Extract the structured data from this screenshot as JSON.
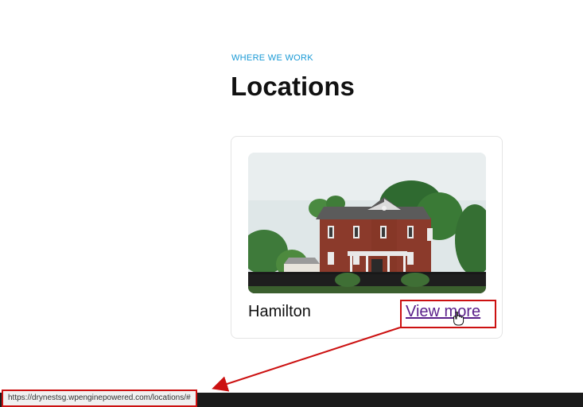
{
  "section": {
    "eyebrow": "WHERE WE WORK",
    "title": "Locations"
  },
  "card": {
    "name": "Hamilton",
    "link_label": "View more"
  },
  "status_bar": {
    "url": "https://drynestsg.wpenginepowered.com/locations/#"
  },
  "colors": {
    "accent": "#1a9ad6",
    "link": "#5a1f8a",
    "annotation": "#cc1111"
  },
  "icons": [
    "hand-cursor-icon"
  ]
}
